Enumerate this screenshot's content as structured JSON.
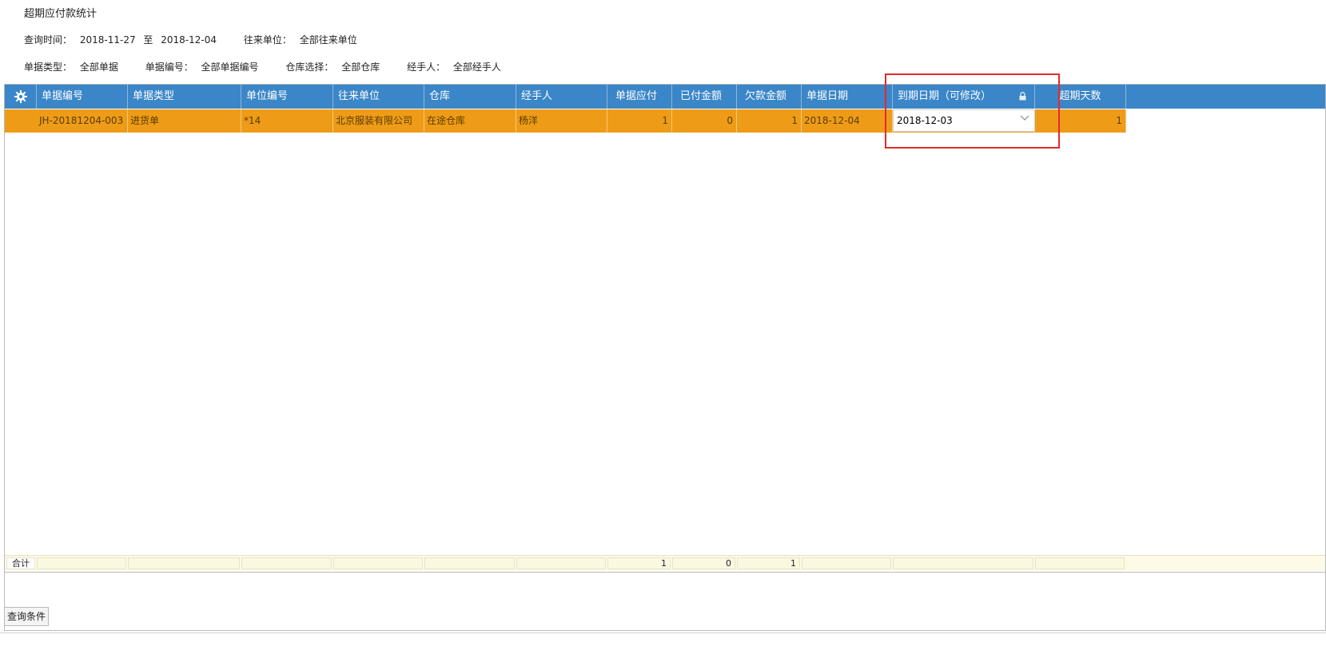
{
  "page": {
    "title": "超期应付款统计"
  },
  "filters": {
    "query_time_label": "查询时间：",
    "date_from": "2018-11-27",
    "to_label": "至",
    "date_to": "2018-12-04",
    "partner_label": "往来单位：",
    "partner_value": "全部往来单位",
    "doc_type_label": "单据类型：",
    "doc_type_value": "全部单据",
    "doc_no_label": "单据编号：",
    "doc_no_value": "全部单据编号",
    "warehouse_label": "仓库选择：",
    "warehouse_value": "全部仓库",
    "handler_label": "经手人：",
    "handler_value": "全部经手人"
  },
  "table": {
    "columns": [
      "单据编号",
      "单据类型",
      "单位编号",
      "往来单位",
      "仓库",
      "经手人",
      "单据应付",
      "已付金额",
      "欠款金额",
      "单据日期",
      "到期日期（可修改）",
      "超期天数"
    ],
    "rows": [
      {
        "doc_no": "JH-20181204-003",
        "doc_type": "进货单",
        "unit_no": "*14",
        "partner": "北京服装有限公司",
        "warehouse": "在途仓库",
        "handler": "杨洋",
        "payable": "1",
        "paid": "0",
        "owed": "1",
        "doc_date": "2018-12-04",
        "due_date": "2018-12-03",
        "overdue_days": "1"
      }
    ],
    "footer": {
      "label": "合计",
      "payable": "1",
      "paid": "0",
      "owed": "1"
    }
  },
  "buttons": {
    "query_conditions": "查询条件"
  },
  "colors": {
    "header_bg": "#3a86c8",
    "selected_row_bg": "#ee9c17",
    "highlight_border": "#e22b2b"
  }
}
